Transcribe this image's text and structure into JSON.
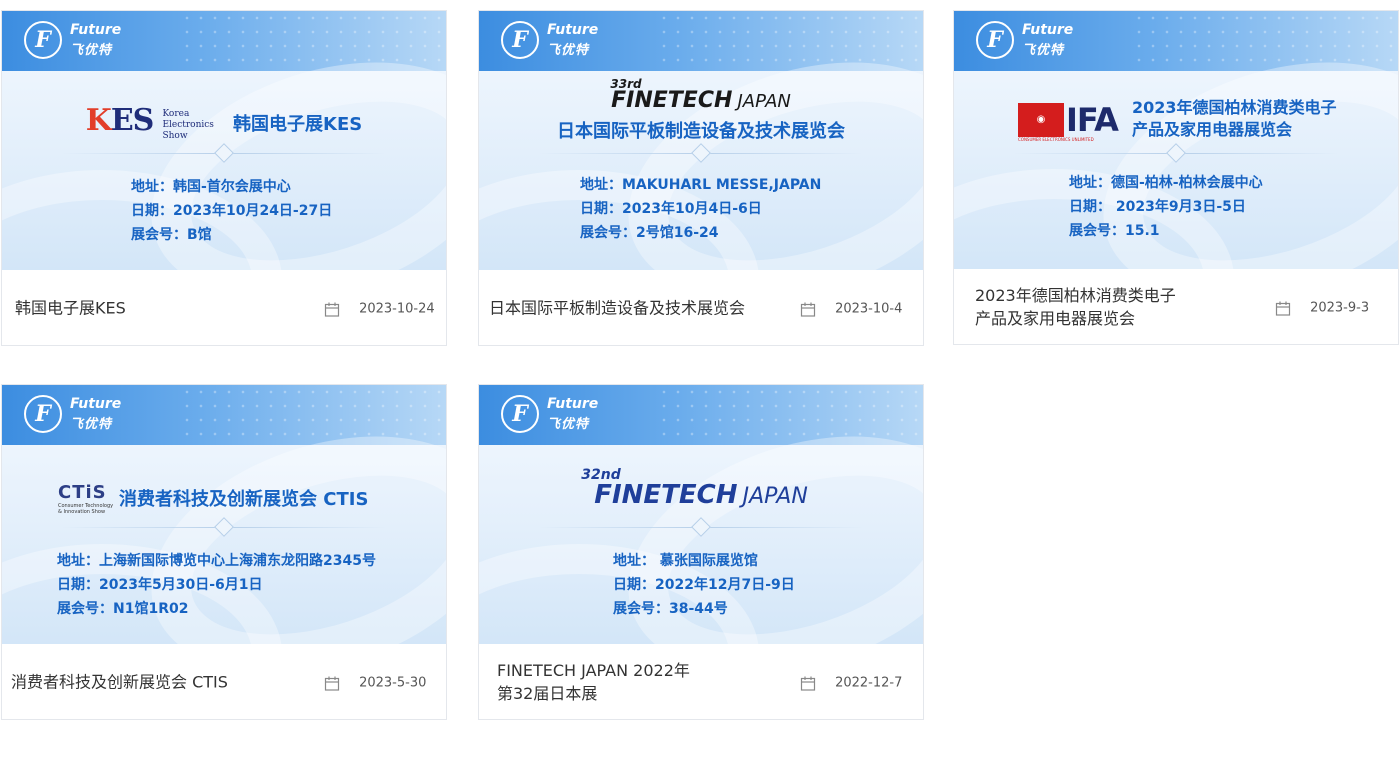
{
  "brand": {
    "en": "Future",
    "cn": "飞优特"
  },
  "cards": [
    {
      "banner_title": "韩国电子展KES",
      "logo_main": "KES",
      "logo_sub_lines": [
        "Korea",
        "Electronics",
        "Show"
      ],
      "address": "地址：韩国-首尔会展中心",
      "period": "日期：2023年10月24日-27日",
      "booth": "展会号：B馆",
      "name_line1": "韩国电子展KES",
      "name_line2": "",
      "date": "2023-10-24"
    },
    {
      "banner_title": "日本国际平板制造设备及技术展览会",
      "logo_num": "33rd",
      "logo_word1": "FINETECH",
      "logo_word2": "JAPAN",
      "address": "地址：MAKUHARL MESSE,JAPAN",
      "period": "日期：2023年10月4日-6日",
      "booth": "展会号：2号馆16-24",
      "name_line1": "日本国际平板制造设备及技术展览会",
      "name_line2": "",
      "date": "2023-10-4"
    },
    {
      "banner_title_1": "2023年德国柏林消费类电子",
      "banner_title_2": "产品及家用电器展览会",
      "logo_main": "IFA",
      "logo_sub": "CONSUMER ELECTRONICS UNLIMITED",
      "address": "地址：德国-柏林-柏林会展中心",
      "period": "日期： 2023年9月3日-5日",
      "booth": "展会号：15.1",
      "name_line1": "2023年德国柏林消费类电子",
      "name_line2": "产品及家用电器展览会",
      "date": "2023-9-3"
    },
    {
      "banner_title": "消费者科技及创新展览会 CTIS",
      "logo_main": "CTiS",
      "logo_sub_lines": [
        "Consumer Technology",
        "& Innovation Show"
      ],
      "address": "地址：上海新国际博览中心上海浦东龙阳路2345号",
      "period": "日期：2023年5月30日-6月1日",
      "booth": "展会号：N1馆1R02",
      "name_line1": "消费者科技及创新展览会 CTIS",
      "name_line2": "",
      "date": "2023-5-30"
    },
    {
      "logo_num": "32nd",
      "logo_word1": "FINETECH",
      "logo_word2": "JAPAN",
      "address": "地址： 慕张国际展览馆",
      "period": "日期：2022年12月7日-9日",
      "booth": "展会号：38-44号",
      "name_line1": "FINETECH JAPAN 2022年",
      "name_line2": "第32届日本展",
      "date": "2022-12-7"
    }
  ],
  "colors": {
    "accent": "#1763c2",
    "header_blue": "#3c8de0",
    "border": "#e4e7ec"
  },
  "icons": {
    "date": "calendar-icon",
    "brand": "future-logo-icon"
  }
}
